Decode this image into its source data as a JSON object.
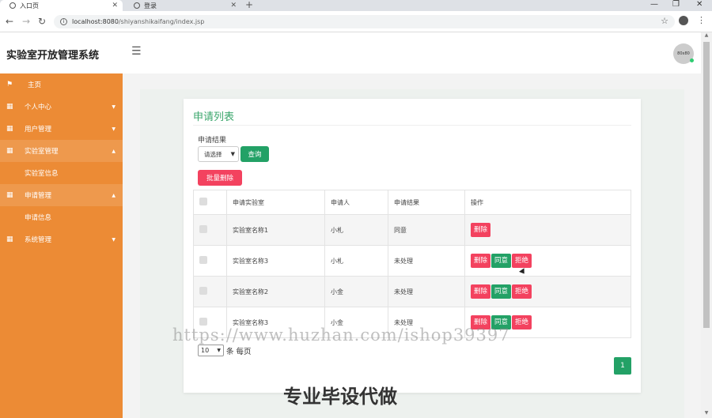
{
  "browser": {
    "tabs": [
      {
        "label": "入口页",
        "active": true
      },
      {
        "label": "登录",
        "active": false
      }
    ],
    "url_host": "localhost:8080",
    "url_path": "/shiyanshikaifang/index.jsp"
  },
  "header": {
    "title": "实验室开放管理系统",
    "avatar_text": "80x80"
  },
  "sidebar": {
    "items": [
      {
        "label": "主页",
        "icon": "flag-icon"
      },
      {
        "label": "个人中心",
        "icon": "grid-icon"
      },
      {
        "label": "用户管理",
        "icon": "grid-icon"
      },
      {
        "label": "实验室管理",
        "icon": "grid-icon"
      },
      {
        "label": "实验室信息"
      },
      {
        "label": "申请管理",
        "icon": "grid-icon"
      },
      {
        "label": "申请信息"
      },
      {
        "label": "系统管理",
        "icon": "grid-icon"
      }
    ]
  },
  "card": {
    "title": "申请列表",
    "filter_label": "申请结果",
    "filter_select": "请选择",
    "query_button": "查询",
    "batch_delete_button": "批量删除",
    "columns": [
      "申请实验室",
      "申请人",
      "申请结果",
      "操作"
    ],
    "rows": [
      {
        "lab": "实验室名称1",
        "applicant": "小札",
        "result": "同意",
        "actions": [
          "删除"
        ]
      },
      {
        "lab": "实验室名称3",
        "applicant": "小札",
        "result": "未处理",
        "actions": [
          "删除",
          "同意",
          "拒绝"
        ]
      },
      {
        "lab": "实验室名称2",
        "applicant": "小金",
        "result": "未处理",
        "actions": [
          "删除",
          "同意",
          "拒绝"
        ]
      },
      {
        "lab": "实验室名称3",
        "applicant": "小金",
        "result": "未处理",
        "actions": [
          "删除",
          "同意",
          "拒绝"
        ]
      }
    ],
    "page_size": "10",
    "page_size_suffix": "条 每页",
    "current_page": "1"
  },
  "watermark": {
    "url": "https://www.huzhan.com/ishop39397",
    "text": "专业毕设代做"
  },
  "colors": {
    "sidebar": "#ec8b35",
    "accent_green": "#23a166",
    "danger": "#f3425f",
    "title_green": "#3aa66b"
  }
}
